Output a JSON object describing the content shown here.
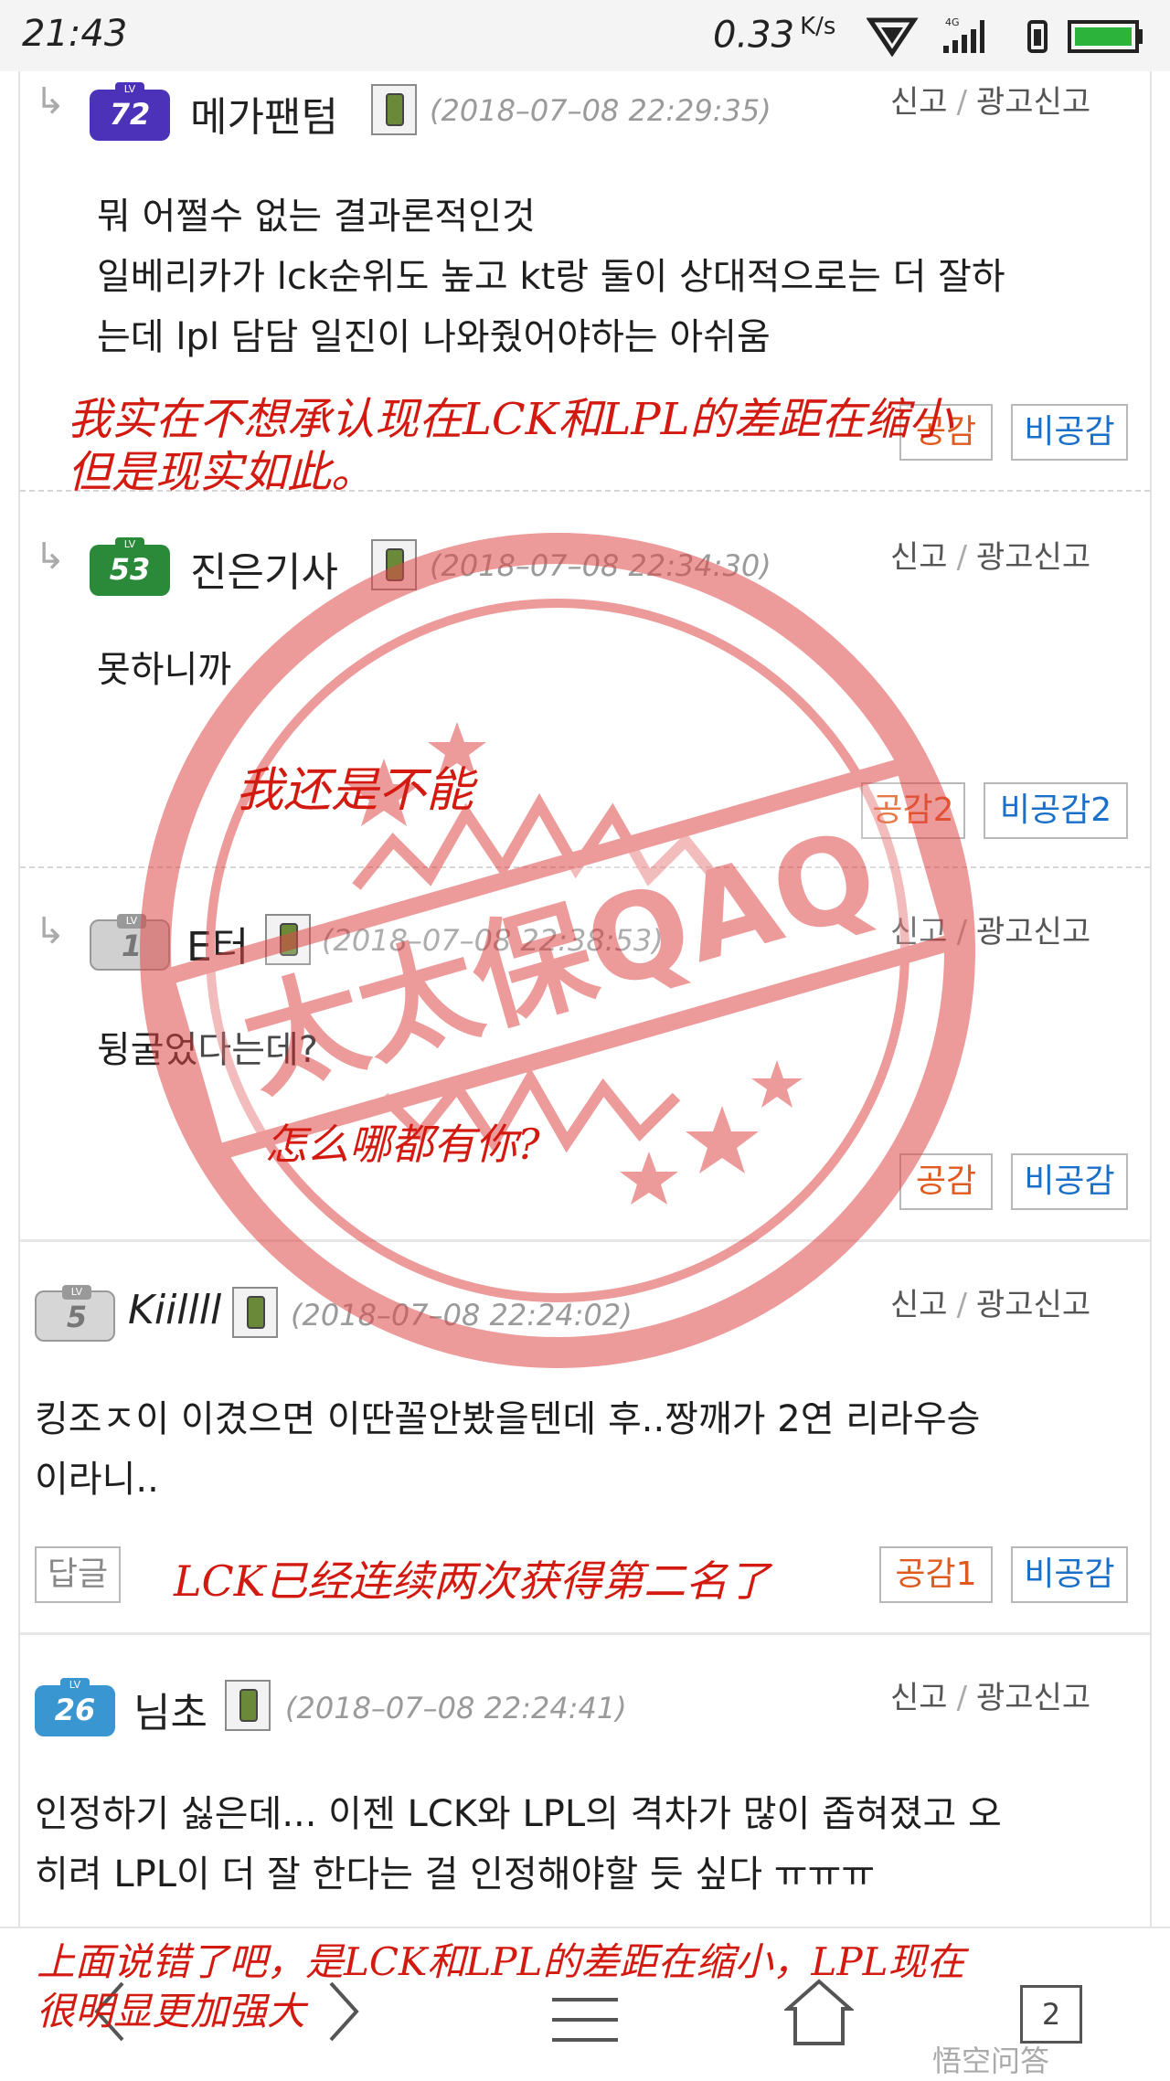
{
  "status_bar": {
    "time": "21:43",
    "speed": "0.33",
    "speed_unit": "K/s",
    "network": "4G"
  },
  "comments": [
    {
      "level": "72",
      "level_color": "#4b32b8",
      "nickname": "메가팬텀",
      "timestamp": "(2018–07–08 22:29:35)",
      "report": "신고",
      "ad_report": "광고신고",
      "lines": [
        "뭐 어쩔수 없는 결과론적인것",
        "일베리카가 lck순위도 높고 kt랑 둘이 상대적으로는 더 잘하",
        "는데 lpl 담담 일진이 나와줬어야하는 아쉬움"
      ],
      "agree": "공감",
      "disagree": "비공감"
    },
    {
      "level": "53",
      "level_color": "#2a8a3a",
      "nickname": "진은기사",
      "timestamp": "(2018–07–08 22:34:30)",
      "report": "신고",
      "ad_report": "광고신고",
      "lines": [
        "못하니까"
      ],
      "agree": "공감2",
      "disagree": "비공감2"
    },
    {
      "level": "1",
      "level_color": "#c8c8c8",
      "nickname": "E터",
      "timestamp": "(2018–07–08 22:38:53)",
      "report": "신고",
      "ad_report": "광고신고",
      "lines": [
        "뒹굴었다는데?"
      ],
      "agree": "공감",
      "disagree": "비공감"
    },
    {
      "level": "5",
      "level_color": "#bdbdbd",
      "nickname": "Kiillll",
      "timestamp": "(2018–07–08 22:24:02)",
      "report": "신고",
      "ad_report": "광고신고",
      "lines": [
        "킹조ㅈ이 이겼으면 이딴꼴안봤을텐데 후..짱깨가 2연 리라우승",
        "이라니.."
      ],
      "reply": "답글",
      "agree": "공감1",
      "disagree": "비공감"
    },
    {
      "level": "26",
      "level_color": "#3a96d0",
      "nickname": "님초",
      "timestamp": "(2018–07–08 22:24:41)",
      "report": "신고",
      "ad_report": "광고신고",
      "lines": [
        "인정하기 싫은데... 이젠 LCK와 LPL의 격차가 많이 좁혀졌고 오",
        "히려 LPL이 더 잘 한다는 걸 인정해야할 듯 싶다 ㅠㅠㅠ"
      ]
    }
  ],
  "annotations": {
    "a1_line1": "我实在不想承认现在LCK和LPL的差距在缩小",
    "a1_line2": "但是现实如此。",
    "a2": "我还是不能",
    "a3": "怎么哪都有你?",
    "a4": "LCK已经连续两次获得第二名了",
    "a5_line1": "上面说错了吧，是LCK和LPL的差距在缩小，LPL现在",
    "a5_line2": "很明显更加强大"
  },
  "stamp_text": "太太保QAQ",
  "navbar": {
    "tab_count": "2",
    "watermark": "悟空问答"
  }
}
